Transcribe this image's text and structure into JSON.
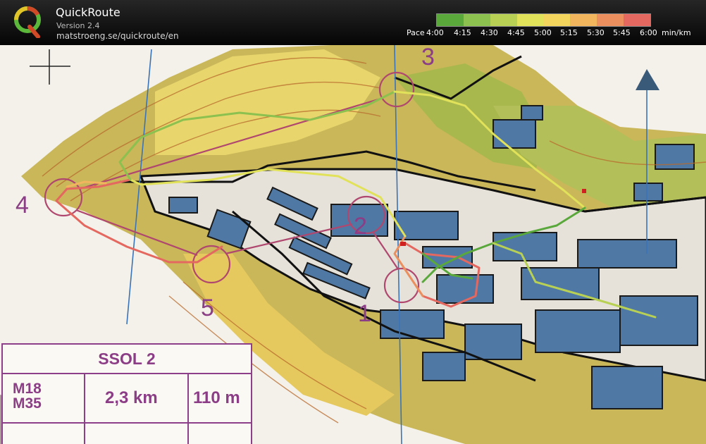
{
  "app": {
    "title": "QuickRoute",
    "version": "Version 2.4",
    "url": "matstroeng.se/quickroute/en"
  },
  "pace_scale": {
    "prefix": "Pace",
    "labels": [
      "4:00",
      "4:15",
      "4:30",
      "4:45",
      "5:00",
      "5:15",
      "5:30",
      "5:45",
      "6:00"
    ],
    "unit": "min/km",
    "colors": [
      "#5aa83c",
      "#8cc04f",
      "#b8d155",
      "#e1e15a",
      "#f3d45c",
      "#f1b55e",
      "#ec8f5e",
      "#e4685f"
    ]
  },
  "map": {
    "controls": [
      {
        "number": "1"
      },
      {
        "number": "2"
      },
      {
        "number": "3"
      },
      {
        "number": "4"
      },
      {
        "number": "5"
      }
    ],
    "colors": {
      "paper": "#f4f1ea",
      "open_land": "#ecd468",
      "green": "#a8b64a",
      "building": "#4f78a4",
      "paved": "#e6e2da",
      "course": "#b0476e",
      "purple": "#8b3d86",
      "magnetic_line": "#3a73b8"
    },
    "course_info": {
      "name": "SSOL 2",
      "classes": "M18\nM35",
      "length": "2,3 km",
      "climb": "110 m"
    }
  }
}
